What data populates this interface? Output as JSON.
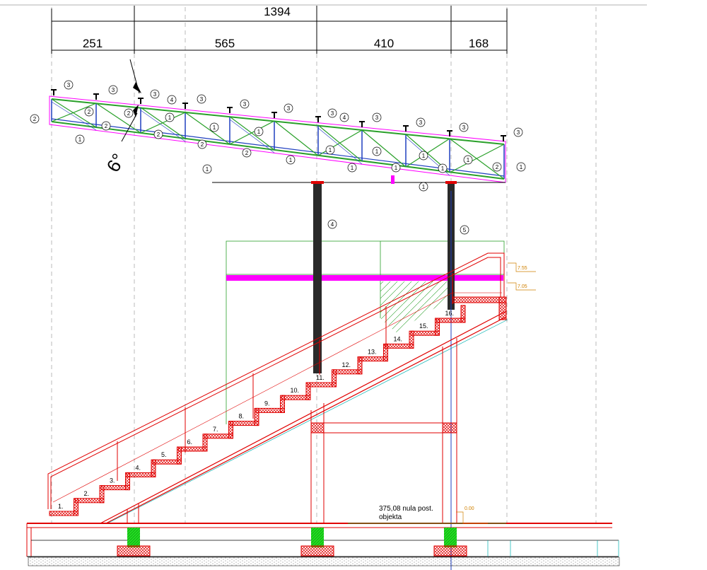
{
  "dimensions": {
    "total": "1394",
    "segments": [
      "251",
      "565",
      "410",
      "168"
    ]
  },
  "roof": {
    "angle_label": "6°",
    "bubble_numbers": [
      "1",
      "2",
      "3",
      "4",
      "5"
    ]
  },
  "stairs": {
    "step_labels": [
      "1.",
      "2.",
      "3.",
      "4.",
      "5.",
      "6.",
      "7.",
      "8.",
      "9.",
      "10.",
      "11.",
      "12.",
      "13.",
      "14.",
      "15.",
      "16."
    ]
  },
  "levels": {
    "upper_1": "7.55",
    "upper_2": "7.05",
    "zero": "0.00"
  },
  "note": {
    "line1": "375,08 nula post.",
    "line2": "objekta"
  },
  "colors": {
    "structure_red": "#e00000",
    "truss_green": "#2aa02a",
    "truss_blue": "#1f3fbf",
    "magenta": "#ff00ff",
    "cyan": "#00b0b0",
    "column_dark": "#2a2a2a",
    "footing_green": "#22dd22",
    "dimension_orange": "#d08000"
  }
}
